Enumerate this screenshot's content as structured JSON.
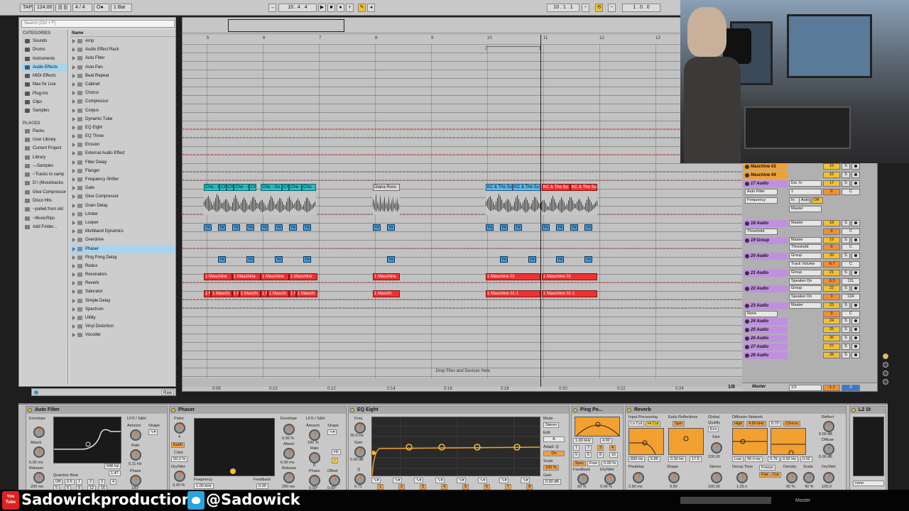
{
  "transport": {
    "tap": "TAP",
    "tempo": "124.00",
    "sig_num": "4",
    "sig_den": "4",
    "quantize": "1 Bar",
    "position": "10 . 4 . 4",
    "loop_start": "10 . 1 . 1",
    "loop_len": "1 . 0 . 0"
  },
  "browser": {
    "search_placeholder": "Search (Ctrl + F)",
    "categories_header": "CATEGORIES",
    "categories": [
      "Sounds",
      "Drums",
      "Instruments",
      "Audio Effects",
      "MIDI Effects",
      "Max for Live",
      "Plug-ins",
      "Clips",
      "Samples"
    ],
    "selected_category": "Audio Effects",
    "places_header": "PLACES",
    "places": [
      "Packs",
      "User Library",
      "Current Project",
      "Library",
      "---Samples",
      "~Tracks to samp",
      "D:\\ (Musicbacku",
      "Glue Compressor",
      "Disco Hits",
      "~pulled from old",
      "~MusicRips",
      "Add Folder..."
    ],
    "name_header": "Name",
    "items": [
      "Amp",
      "Audio Effect Rack",
      "Auto Filter",
      "Auto Pan",
      "Beat Repeat",
      "Cabinet",
      "Chorus",
      "Compressor",
      "Corpus",
      "Dynamic Tube",
      "EQ Eight",
      "EQ Three",
      "Erosion",
      "External Audio Effect",
      "Filter Delay",
      "Flanger",
      "Frequency Shifter",
      "Gate",
      "Glue Compressor",
      "Grain Delay",
      "Limiter",
      "Looper",
      "Multiband Dynamics",
      "Overdrive",
      "Phaser",
      "Ping Pong Delay",
      "Redux",
      "Resonators",
      "Reverb",
      "Saturator",
      "Simple Delay",
      "Spectrum",
      "Utility",
      "Vinyl Distortion",
      "Vocoder"
    ],
    "selected_item": "Phaser",
    "raw_label": "Raw"
  },
  "arrangement": {
    "bars": [
      "5",
      "6",
      "7",
      "8",
      "9",
      "10",
      "11",
      "12",
      "13"
    ],
    "times": [
      "0:08",
      "0:10",
      "0:12",
      "0:14",
      "0:16",
      "0:18",
      "0:20",
      "0:22",
      "0:24"
    ],
    "drop_hint": "Drop Files and Devices Here",
    "clip_chic": "Chic - Go",
    "clip_chic_short": "Chic",
    "clip_chic_end": "Chic -",
    "clip_diana": "Diana Ross",
    "clip_kc": "KC & The Su",
    "clip_kc_end": "KC & The Su",
    "clip_tr": "TR",
    "clip_maschine": "1 Maschine",
    "clip_maschine01": "1 Maschine 01",
    "clip_maschine011": "1 Maschine 01-1",
    "clip_maschine_small": "1 Maschi"
  },
  "mixer": {
    "tracks": [
      {
        "name": "Maschine 03",
        "num": "15"
      },
      {
        "name": "Maschine 04",
        "num": "16"
      },
      {
        "name": "17 Audio",
        "io": "Ext. In",
        "num": "17"
      },
      {
        "name": "18 Audio",
        "io": "Master",
        "num": "18"
      },
      {
        "name": "19 Group",
        "io": "Master",
        "num": "19"
      },
      {
        "name": "20 Audio",
        "io": "Group",
        "num": "20"
      },
      {
        "name": "21 Audio",
        "io": "Group",
        "num": "21"
      },
      {
        "name": "22 Audio",
        "io": "Group",
        "num": "22"
      },
      {
        "name": "23 Audio",
        "io": "Master",
        "num": "23"
      },
      {
        "name": "24 Audio",
        "num": "24"
      },
      {
        "name": "25 Audio",
        "num": "25"
      },
      {
        "name": "26 Audio",
        "num": "26"
      },
      {
        "name": "27 Audio",
        "num": "27"
      },
      {
        "name": "28 Audio",
        "num": "28"
      }
    ],
    "sub_autofilter": "Auto Filter",
    "sub_frequency": "Frequency",
    "sub_threshold": "Threshold",
    "sub_trackvol": "Track Volume",
    "sub_speaker": "Speaker On",
    "sub_none": "None",
    "sub_in": "In",
    "sub_auto": "Auto",
    "sub_off": "Off",
    "sub_one": "1",
    "vol_zero": "0",
    "vol_neg": "-5.3",
    "vol_neg2": "-6.7",
    "pan_c": "C",
    "pan_12l": "12L",
    "pan_11r": "11R",
    "master_label": "Master",
    "master_ratio": "1/8",
    "master_quant": "1/2",
    "master_vol": "-1.1",
    "master_pan": "0"
  },
  "devices": {
    "autofilter": {
      "title": "Auto Filter",
      "envelope": "Envelope",
      "amount": "Amount",
      "attack": "Attack",
      "release": "Release",
      "attack_val": "6.00 ms",
      "release_val": "200 ms",
      "lfo": "LFO / S&H",
      "lfo_amount": "Amount",
      "shape": "Shape",
      "rate": "Rate",
      "rate_val": "0.11 Hz",
      "phase": "Phase",
      "phase_val": "180°",
      "freq_val": "648 Hz",
      "q_val": "1.47",
      "quantize_beat": "Quantize Beat",
      "q_options": [
        "Off",
        "0.5",
        "1",
        "2",
        "3",
        "4",
        "5",
        "6",
        "8",
        "12",
        "16"
      ]
    },
    "phaser": {
      "title": "Phaser",
      "poles": "Poles",
      "poles_val": "4",
      "earth": "Earth",
      "color": "Color",
      "color_val": "50.0 %",
      "drywet": "Dry/Wet",
      "drywet_val": "0.00 %",
      "frequency": "Frequency",
      "frequency_val": "1.00 kHz",
      "feedback": "Feedback",
      "feedback_val": "0.00",
      "envelope": "Envelope",
      "env_amount": "0.00 %",
      "attack": "Attack",
      "attack_val": "6.00 ms",
      "release": "Release",
      "release_val": "200 ms",
      "lfo": "LFO / S&H",
      "lfo_amount": "Amount",
      "lfo_amount_val": "100 %",
      "shape": "Shape",
      "rate": "Rate",
      "rate_val": "8",
      "hz": "Hz",
      "phase": "Phase",
      "phase_val": "0.00°",
      "offset": "Offset",
      "offset_val": "0.00°"
    },
    "eq": {
      "title": "EQ Eight",
      "freq": "Freq",
      "freq_val": "30.0 Hz",
      "gain": "Gain",
      "gain_val": "0.00 dB",
      "q": "Q",
      "q_val": "0.71",
      "mode": "Mode",
      "mode_val": "Stereo",
      "edit": "Edit",
      "edit_val": "A",
      "adapt": "Adapt. Q",
      "adapt_val": "On",
      "scale": "Scale",
      "scale_val": "100 %",
      "out_gain": "Gain",
      "out_gain_val": "0.00 dB",
      "band_labels": [
        "1",
        "2",
        "3",
        "4",
        "5",
        "6",
        "7",
        "8"
      ],
      "grid_labels": [
        "12",
        "6",
        "0",
        "-6",
        "-12"
      ],
      "freq_labels": [
        "100",
        "1k",
        "10k"
      ]
    },
    "pingpong": {
      "title": "Ping Po...",
      "freq_val": "1.00 kHz",
      "q_val": "4.00",
      "beat_opts": [
        "1",
        "2",
        "3",
        "4",
        "5",
        "6",
        "8",
        "16"
      ],
      "sync": "Sync",
      "free": "Free",
      "delay_pct": "0.00 %",
      "feedback": "Feedback",
      "feedback_val": "60 %",
      "drywet": "Dry/Wet",
      "drywet_val": "0.00 %"
    },
    "reverb": {
      "title": "Reverb",
      "input": "Input Processing",
      "locut": "Lo Cut",
      "hicut": "Hi Cut",
      "early": "Early Reflections",
      "spin": "Spin",
      "global": "Global",
      "quality": "Quality",
      "eco": "Eco",
      "diffusion": "Diffusion Network",
      "high": "High",
      "high_val": "4.50 kHz",
      "high_ratio": "0.70",
      "chorus": "Chorus",
      "reflect": "Reflect",
      "reflect_val": "0.00 dB",
      "size": "Size",
      "size_val": "100.00",
      "in_freq": "830 Hz",
      "in_q": "5.85",
      "er_amt": "0.30 Hz",
      "er_amt2": "17.5",
      "low": "Low",
      "low_val": "90.0 Hz",
      "low_ratio": "0.75",
      "er_freq": "0.02 Hz",
      "er_q": "0.02",
      "diffuse": "Diffuse",
      "diffuse_val": "0.00 dB",
      "predelay": "Predelay",
      "predelay_val": "2.50 ms",
      "shape": "Shape",
      "shape_val": "0.50",
      "stereo": "Stereo",
      "stereo_val": "100.00",
      "decay": "Decay Time",
      "decay_val": "1.20 s",
      "freeze": "Freeze",
      "flat": "Flat",
      "cut": "Cut",
      "density": "Density",
      "density_val": "60 %",
      "scale": "Scale",
      "scale_val": "40 %",
      "drywet": "Dry/Wet",
      "drywet_val": "100.0"
    },
    "l2": {
      "title": "L2 St",
      "none_val": "none"
    }
  },
  "brand": {
    "youtube_icon_top": "You",
    "youtube_icon_bottom": "Tube",
    "youtube": "Sadowickproduction",
    "twitter": "@Sadowick"
  },
  "master_bottom": "Master"
}
